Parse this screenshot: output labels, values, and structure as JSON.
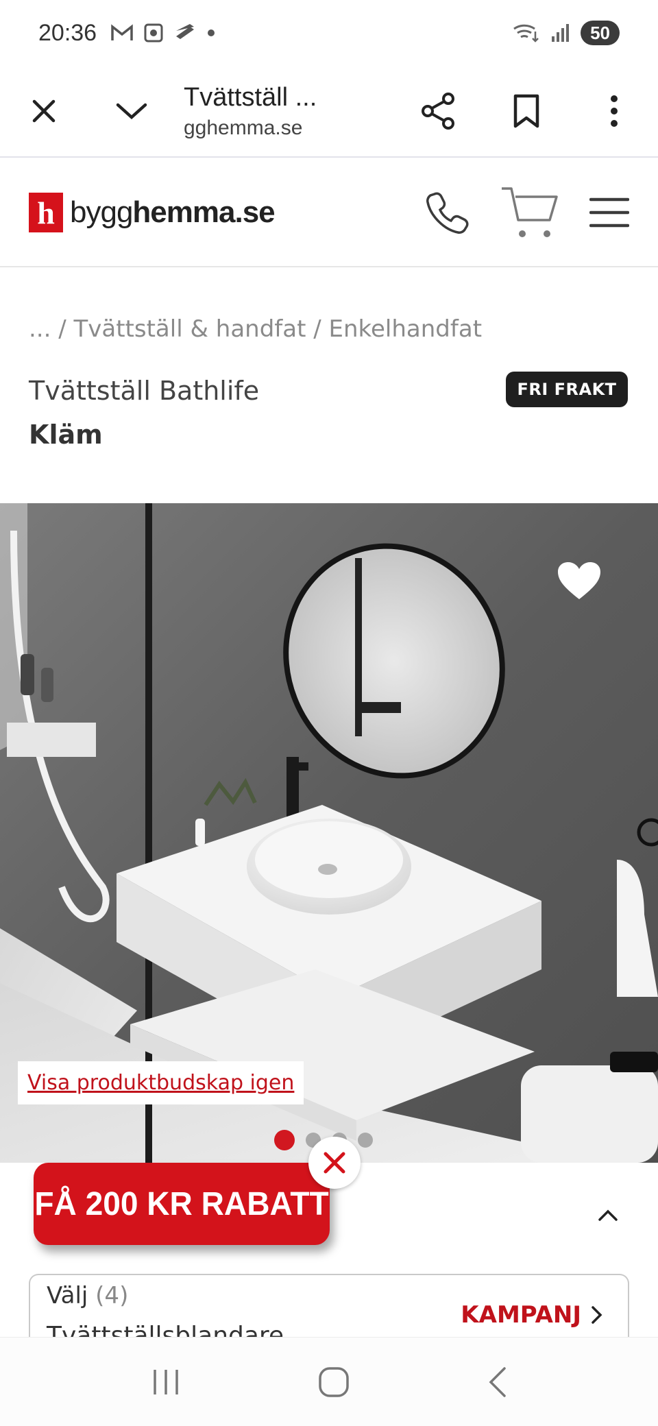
{
  "status_bar": {
    "time": "20:36",
    "battery": "50"
  },
  "tab_bar": {
    "title": "Tvättställ ...",
    "url": "gghemma.se"
  },
  "site": {
    "logo_letter": "h",
    "logo_prefix": "bygg",
    "logo_suffix": "hemma.se",
    "brand_color": "#d5121b"
  },
  "breadcrumb": "... / Tvättställ & handfat / Enkelhandfat",
  "product": {
    "title": "Tvättställ Bathlife",
    "subtitle": "Kläm",
    "badge": "FRI FRAKT"
  },
  "hero": {
    "visa_link": "Visa produktbudskap igen",
    "slide_count": 4,
    "active_slide": 1
  },
  "promo": {
    "label": "FÅ 200 KR RABATT"
  },
  "option": {
    "label": "Välj",
    "count": "(4)",
    "name": "Tvättställsblandare",
    "cta": "KAMPANJ"
  },
  "icons": [
    "close-icon",
    "chevron-down-icon",
    "share-icon",
    "bookmark-icon",
    "more-icon",
    "phone-icon",
    "cart-icon",
    "menu-icon",
    "heart-icon",
    "chevron-up-icon",
    "chevron-right-icon",
    "recent-apps-icon",
    "home-icon",
    "back-icon"
  ]
}
